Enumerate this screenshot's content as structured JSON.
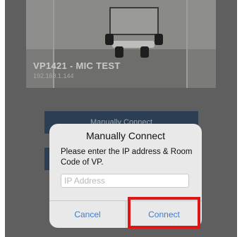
{
  "room": {
    "title": "VP1421 - MIC TEST",
    "ip": "192.168.1.144"
  },
  "background_buttons": {
    "manual_label": "Manually Connect"
  },
  "dialog": {
    "title": "Manually Connect",
    "message": "Please enter the IP address & Room Code of VP.",
    "input_placeholder": "IP Address",
    "input_value": "",
    "cancel_label": "Cancel",
    "connect_label": "Connect"
  },
  "colors": {
    "highlight": "#e01616",
    "button_text": "#3c7cd1"
  }
}
